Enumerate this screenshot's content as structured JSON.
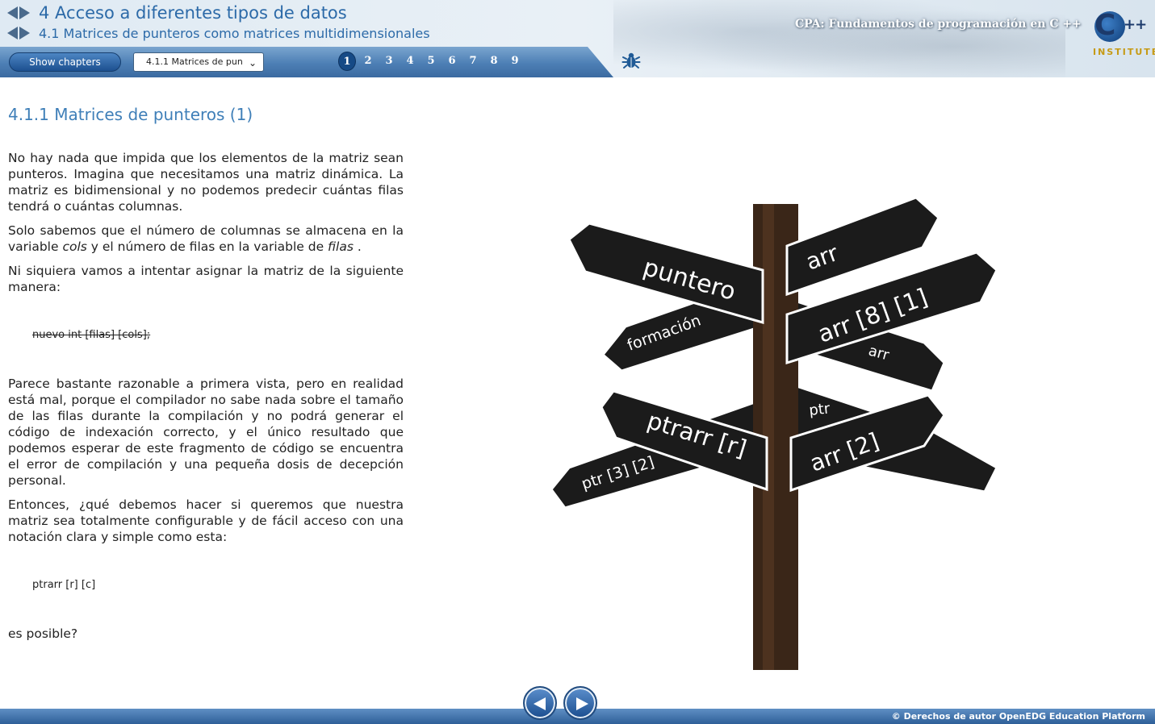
{
  "header": {
    "chapter_title": "4 Acceso a diferentes tipos de datos",
    "section_title": "4.1 Matrices de punteros como matrices multidimensionales",
    "course_title": "CPA: Fundamentos de programación en C ++",
    "logo": {
      "letter": "C",
      "plus": "++",
      "institute": "INSTITUTE"
    }
  },
  "toolbar": {
    "show_chapters_label": "Show chapters",
    "select_value": "4.1.1 Matrices de pun",
    "pages": [
      "1",
      "2",
      "3",
      "4",
      "5",
      "6",
      "7",
      "8",
      "9"
    ],
    "active_page": "1"
  },
  "content": {
    "title": "4.1.1 Matrices de punteros (1)",
    "p1": "No hay nada que impida que los elementos de la matriz sean punteros. Imagina que necesitamos una matriz dinámica. La matriz es bidimensional y no podemos predecir cuántas filas tendrá o cuántas columnas.",
    "p2_before_cols": "Solo sabemos que el número de columnas se almacena en la variable ",
    "p2_cols": "cols",
    "p2_mid": " y el número de filas en la variable de ",
    "p2_filas": "filas",
    "p2_end": " .",
    "p3": "Ni siquiera vamos a intentar asignar la matriz de la siguiente manera:",
    "code1": "nuevo int [filas] [cols];",
    "p4": "Parece bastante razonable a primera vista, pero en realidad está mal, porque el compilador no sabe nada sobre el tamaño de las filas durante la compilación y no podrá generar el código de indexación correcto, y el único resultado que podemos esperar de este fragmento de código se encuentra el error de compilación y una pequeña dosis de decepción personal.",
    "p5": "Entonces, ¿qué debemos hacer si queremos que nuestra matriz sea totalmente configurable y de fácil acceso con una notación clara y simple como esta:",
    "code2": "ptrarr [r] [c]",
    "p6": "es posible?"
  },
  "signpost": {
    "labels": [
      "puntero",
      "arr",
      "formación",
      "arr [8] [1]",
      "arr",
      "ptrarr [r]",
      "ptr",
      "arr [2]",
      "ptr [3] [2]"
    ]
  },
  "footer": {
    "copyright": "© Derechos de autor OpenEDG Education Platform"
  },
  "colors": {
    "accent": "#2c6aa8",
    "toolbar": "#4d7fb5",
    "sign": "#1b1b1b",
    "post": "#3a2618"
  },
  "icons": {
    "bug": "bug-icon",
    "prev": "prev-arrow-icon",
    "next": "next-arrow-icon"
  }
}
